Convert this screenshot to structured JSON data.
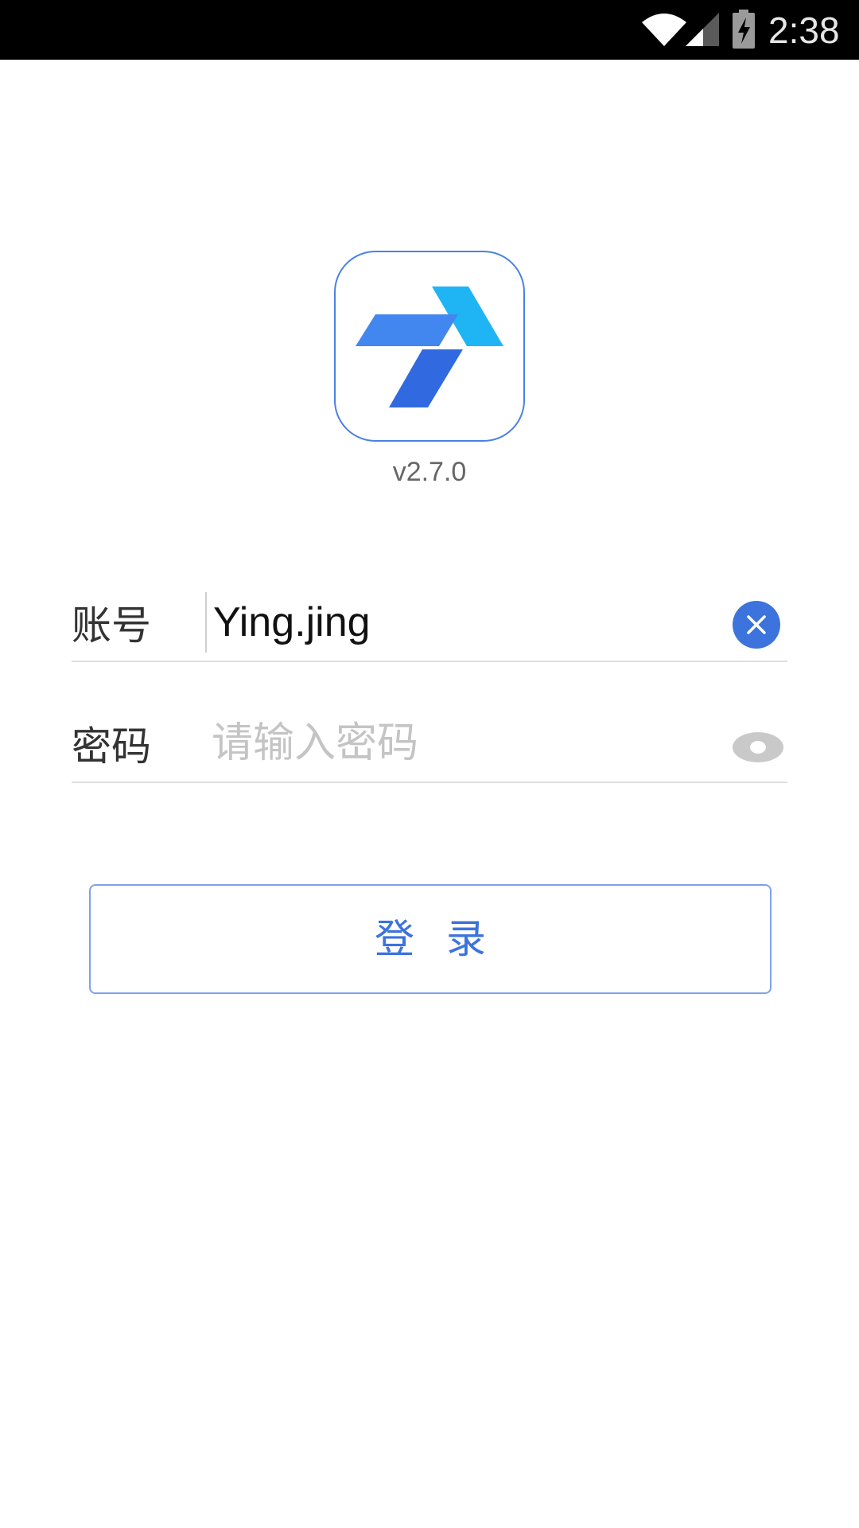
{
  "status_bar": {
    "time": "2:38",
    "icons": [
      "wifi-icon",
      "signal-icon",
      "battery-charging-icon"
    ]
  },
  "app": {
    "logo": "app-logo",
    "version": "v2.7.0"
  },
  "form": {
    "account": {
      "label": "账号",
      "value": "Ying.jing",
      "clear_icon": "clear-icon"
    },
    "password": {
      "label": "密码",
      "value": "",
      "placeholder": "请输入密码",
      "toggle_icon": "eye-icon"
    }
  },
  "login_button": {
    "label": "登录"
  },
  "colors": {
    "accent": "#3c73dc",
    "logo_light_blue": "#1fb5f5",
    "logo_blue": "#4286f0",
    "logo_dark_blue": "#316ae0",
    "divider": "#dedede",
    "placeholder": "#c4c4c4"
  }
}
